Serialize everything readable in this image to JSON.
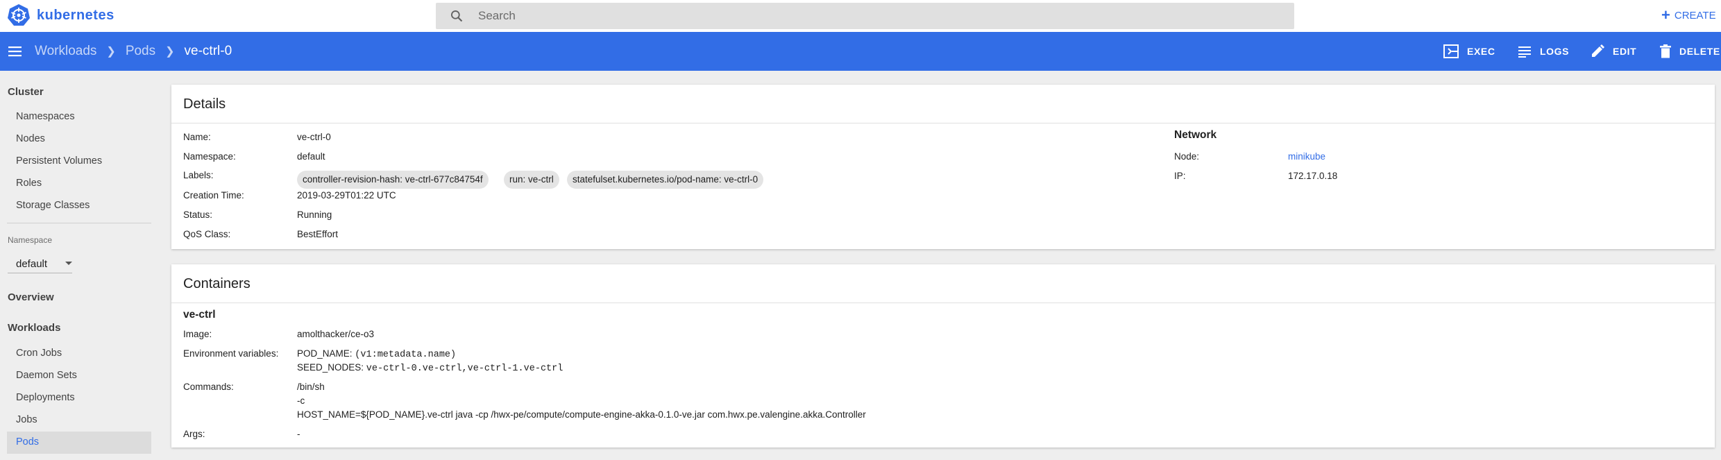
{
  "app": {
    "brand": "kubernetes",
    "logo_icon": "kubernetes-helm-icon",
    "accent_color": "#326de6"
  },
  "search": {
    "placeholder": "Search",
    "value": ""
  },
  "topbar": {
    "create_label": "CREATE"
  },
  "breadcrumb": {
    "items": [
      "Workloads",
      "Pods"
    ],
    "current": "ve-ctrl-0"
  },
  "actions": {
    "exec": "EXEC",
    "logs": "LOGS",
    "edit": "EDIT",
    "delete": "DELETE"
  },
  "sidebar": {
    "cluster_header": "Cluster",
    "cluster_items": [
      "Namespaces",
      "Nodes",
      "Persistent Volumes",
      "Roles",
      "Storage Classes"
    ],
    "namespace_label": "Namespace",
    "namespace_value": "default",
    "overview": "Overview",
    "workloads_header": "Workloads",
    "workload_items": [
      "Cron Jobs",
      "Daemon Sets",
      "Deployments",
      "Jobs",
      "Pods"
    ],
    "active_item": "Pods"
  },
  "details": {
    "title": "Details",
    "name_label": "Name:",
    "name": "ve-ctrl-0",
    "namespace_label": "Namespace:",
    "namespace": "default",
    "labels_label": "Labels:",
    "labels": [
      "controller-revision-hash: ve-ctrl-677c84754f",
      "run: ve-ctrl",
      "statefulset.kubernetes.io/pod-name: ve-ctrl-0"
    ],
    "creation_label": "Creation Time:",
    "creation_time": "2019-03-29T01:22 UTC",
    "status_label": "Status:",
    "status": "Running",
    "qos_label": "QoS Class:",
    "qos": "BestEffort",
    "network": {
      "title": "Network",
      "node_label": "Node:",
      "node": "minikube",
      "ip_label": "IP:",
      "ip": "172.17.0.18"
    }
  },
  "containers": {
    "title": "Containers",
    "name": "ve-ctrl",
    "image_label": "Image:",
    "image": "amolthacker/ce-o3",
    "env_label": "Environment variables:",
    "env": [
      {
        "key": "POD_NAME:",
        "value": "(v1:metadata.name)"
      },
      {
        "key": "SEED_NODES:",
        "value": "ve-ctrl-0.ve-ctrl,ve-ctrl-1.ve-ctrl"
      }
    ],
    "commands_label": "Commands:",
    "commands": [
      "/bin/sh",
      "-c",
      "HOST_NAME=${POD_NAME}.ve-ctrl java -cp /hwx-pe/compute/compute-engine-akka-0.1.0-ve.jar com.hwx.pe.valengine.akka.Controller"
    ],
    "args_label": "Args:",
    "args": "-"
  }
}
